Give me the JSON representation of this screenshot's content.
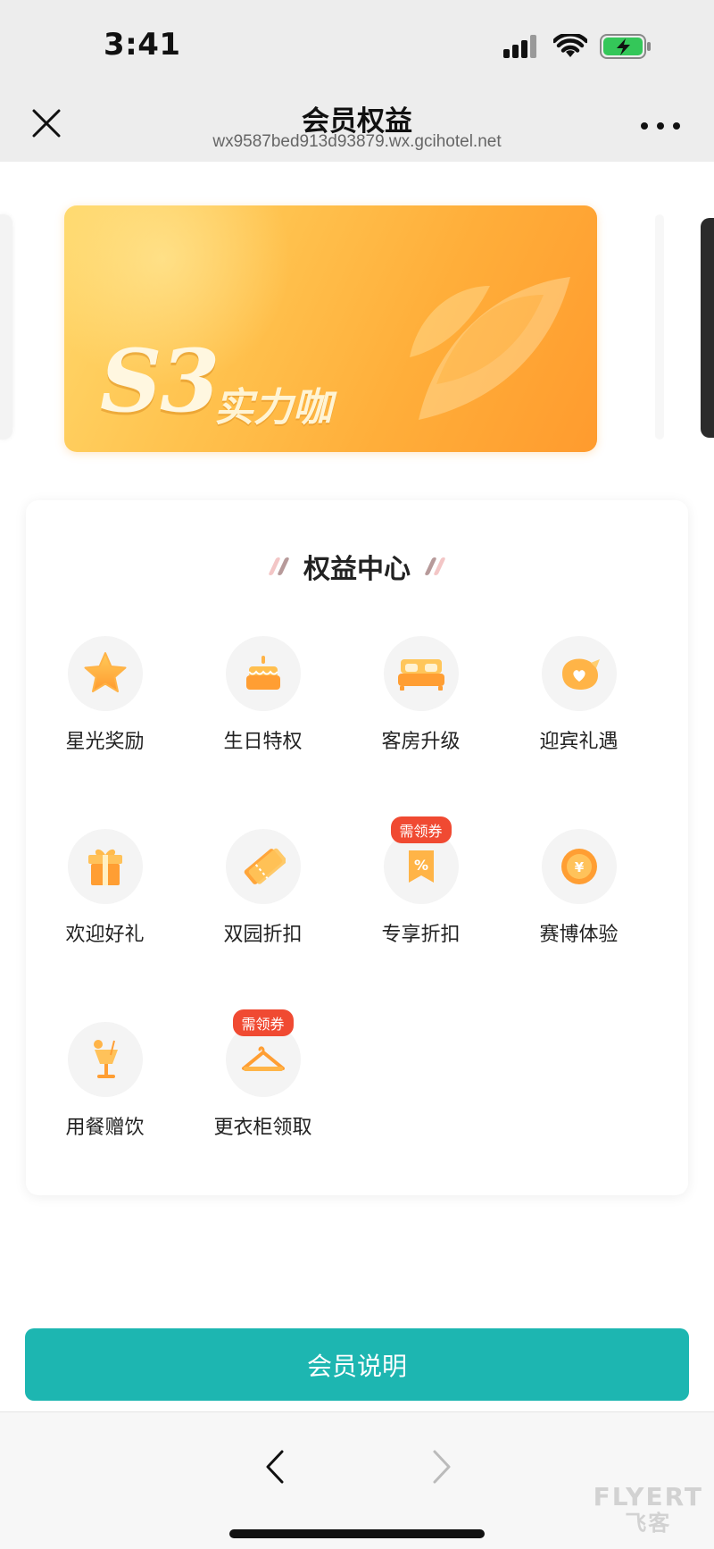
{
  "status_bar": {
    "time": "3:41",
    "battery_color": "#34c759"
  },
  "nav": {
    "title": "会员权益",
    "url": "wx9587bed913d93879.wx.gcihotel.net"
  },
  "card": {
    "level": "S3",
    "name": "实力咖"
  },
  "benefits": {
    "title": "权益中心",
    "items": [
      {
        "label": "星光奖励",
        "icon": "star-icon",
        "tag": ""
      },
      {
        "label": "生日特权",
        "icon": "cake-icon",
        "tag": ""
      },
      {
        "label": "客房升级",
        "icon": "bed-icon",
        "tag": ""
      },
      {
        "label": "迎宾礼遇",
        "icon": "bird-heart-icon",
        "tag": ""
      },
      {
        "label": "欢迎好礼",
        "icon": "gift-icon",
        "tag": ""
      },
      {
        "label": "双园折扣",
        "icon": "ticket-icon",
        "tag": ""
      },
      {
        "label": "专享折扣",
        "icon": "discount-icon",
        "tag": "需领券"
      },
      {
        "label": "赛博体验",
        "icon": "coin-icon",
        "tag": ""
      },
      {
        "label": "用餐赠饮",
        "icon": "drink-icon",
        "tag": ""
      },
      {
        "label": "更衣柜领取",
        "icon": "hanger-icon",
        "tag": "需领券"
      }
    ]
  },
  "cta": {
    "label": "会员说明",
    "color": "#1db6b1"
  },
  "watermark": {
    "top": "FLYERT",
    "bottom": "飞客"
  },
  "colors": {
    "accent_orange": "#ffa53a",
    "tag_red": "#f04a32"
  }
}
